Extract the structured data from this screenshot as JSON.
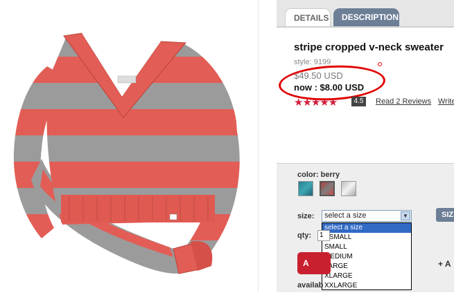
{
  "tabs": [
    {
      "label": "DETAILS"
    },
    {
      "label": "DESCRIPTION"
    }
  ],
  "product": {
    "title": "stripe cropped v-neck sweater",
    "style": "style: 9199",
    "price_was": "$49.50 USD",
    "price_now": "now : $8.00 USD",
    "stars_glyph": "★★★★★",
    "rating": "4.5",
    "reviews_link": "Read 2 Reviews",
    "write_link": "Write"
  },
  "options": {
    "color_label": "color:",
    "color_value": "berry",
    "swatches": [
      "teal",
      "berry",
      "grey"
    ],
    "size_label": "size:",
    "size_selected": "select a size",
    "size_options": [
      "select a size",
      "XSMALL",
      "SMALL",
      "MEDIUM",
      "LARGE",
      "XLARGE",
      "XXLARGE"
    ],
    "qty_label": "qty:",
    "qty_value": "1",
    "size_chart_label": "SIZ",
    "add_label": "A",
    "plus_label": "+ A",
    "availability_label": "availab"
  },
  "colors": {
    "tab_active_bg": "#6d7f96",
    "highlight_circle": "#e00000",
    "stars": "#d21f3c",
    "add_button": "#c8202f",
    "dropdown_highlight": "#316ac5"
  }
}
